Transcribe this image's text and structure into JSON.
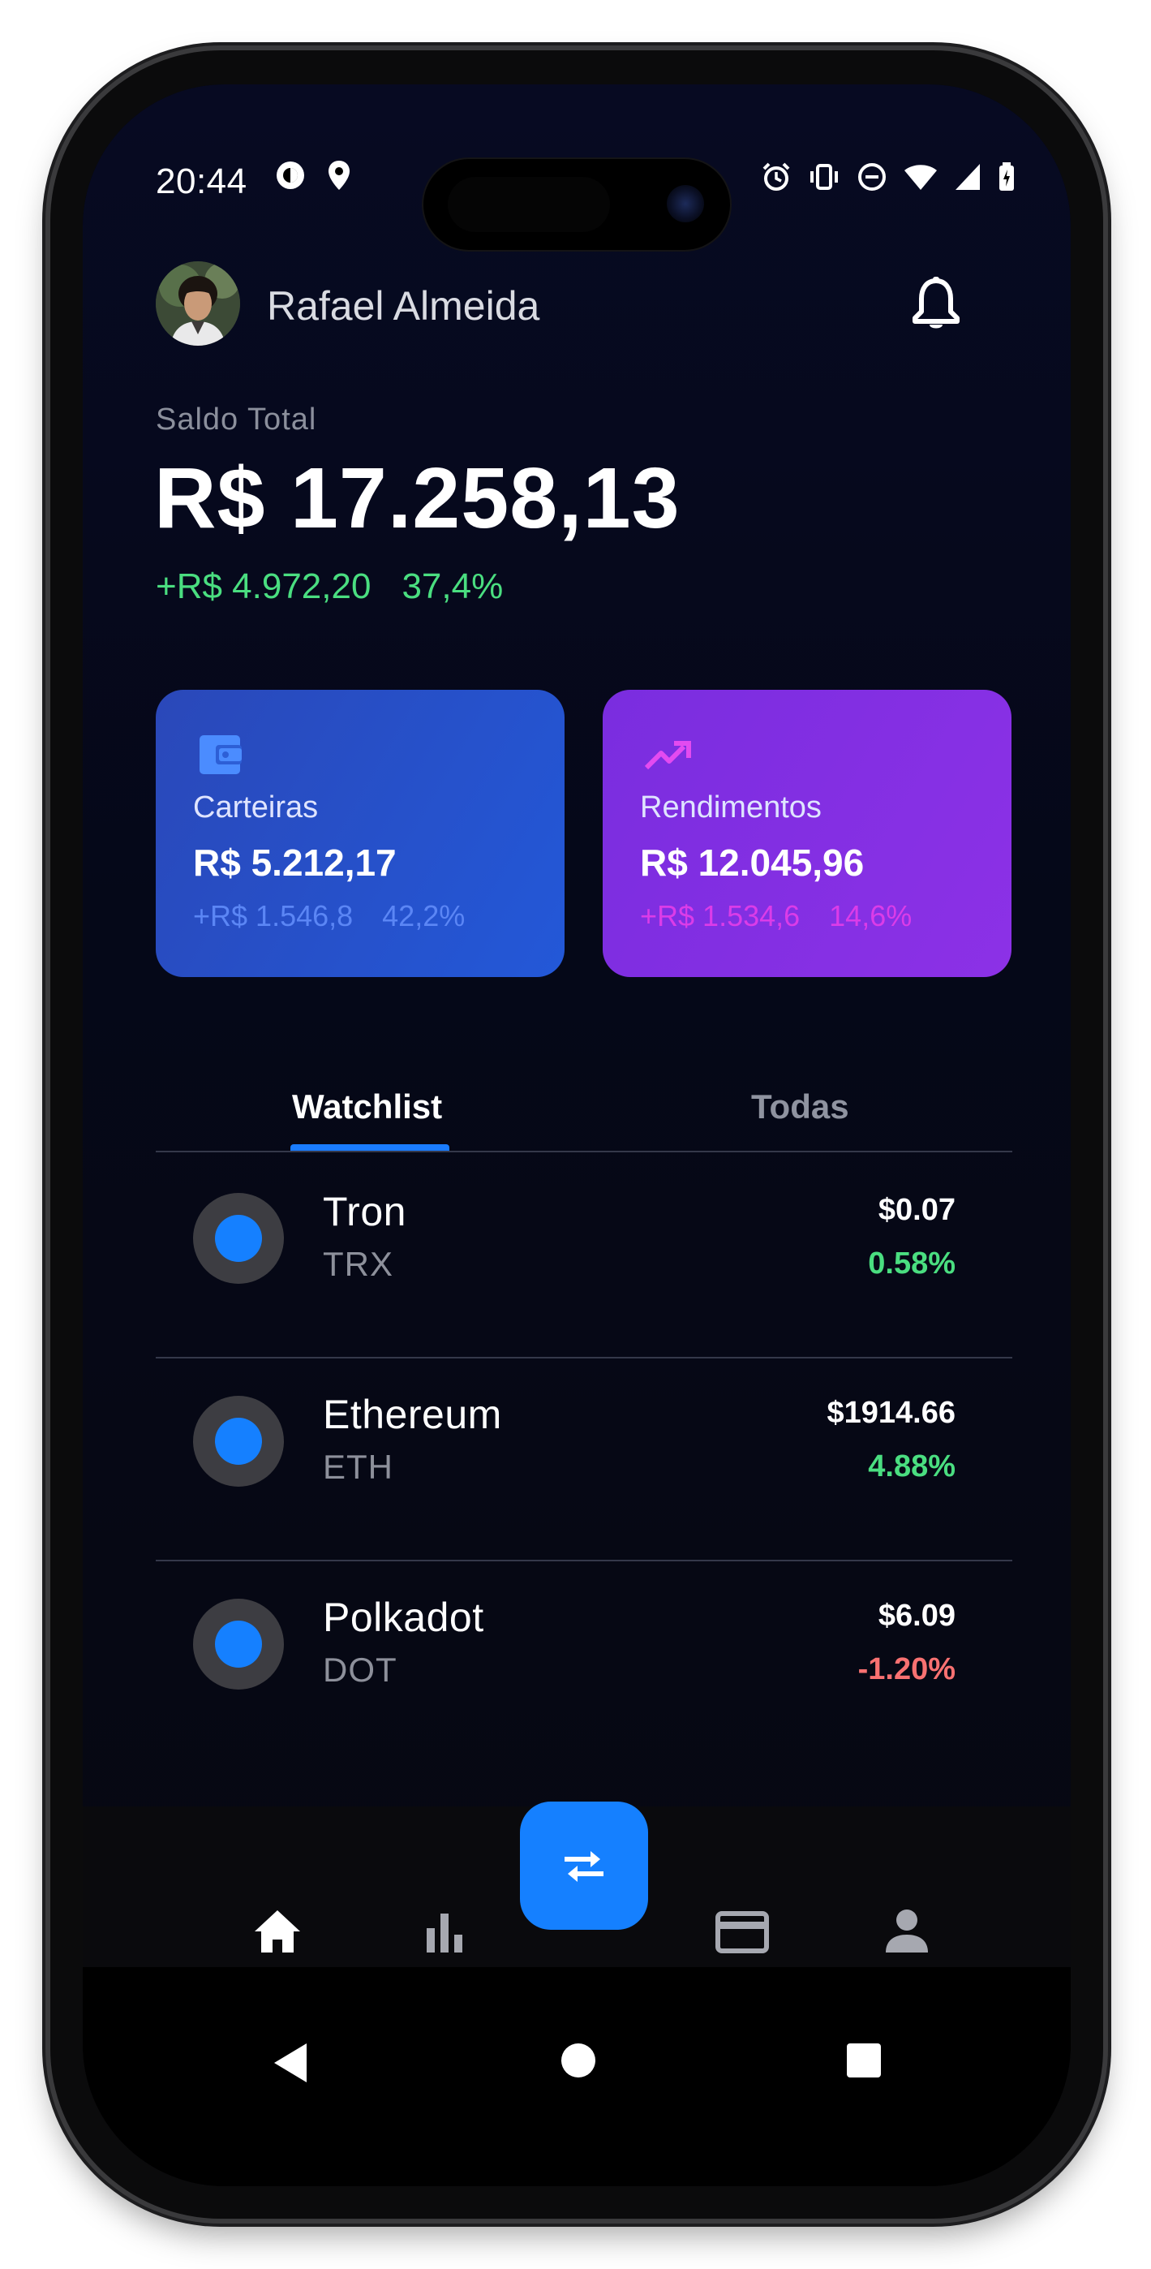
{
  "status_bar": {
    "time": "20:44",
    "left_icons": [
      "data-saver-icon",
      "location-icon"
    ],
    "right_icons": [
      "alarm-icon",
      "vibrate-icon",
      "dnd-icon",
      "wifi-icon",
      "signal-icon",
      "battery-icon"
    ]
  },
  "header": {
    "user_name": "Rafael Almeida",
    "avatar": "avatar",
    "notification_icon": "bell-icon"
  },
  "balance": {
    "label": "Saldo Total",
    "value": "R$ 17.258,13",
    "delta_amount": "+R$ 4.972,20",
    "delta_percent": "37,4%"
  },
  "cards": [
    {
      "icon": "wallet-icon",
      "label": "Carteiras",
      "value": "R$ 5.212,17",
      "delta_amount": "+R$ 1.546,8",
      "delta_percent": "42,2%",
      "color": "#2452d0"
    },
    {
      "icon": "trending-up-icon",
      "label": "Rendimentos",
      "value": "R$ 12.045,96",
      "delta_amount": "+R$ 1.534,6",
      "delta_percent": "14,6%",
      "color": "#8430e4"
    }
  ],
  "tabs": {
    "watchlist": "Watchlist",
    "all": "Todas",
    "active": "watchlist"
  },
  "coins": [
    {
      "name": "Tron",
      "symbol": "TRX",
      "price": "$0.07",
      "change": "0.58%",
      "trend": "up"
    },
    {
      "name": "Ethereum",
      "symbol": "ETH",
      "price": "$1914.66",
      "change": "4.88%",
      "trend": "up"
    },
    {
      "name": "Polkadot",
      "symbol": "DOT",
      "price": "$6.09",
      "change": "-1.20%",
      "trend": "down"
    }
  ],
  "bottom_nav": {
    "items": [
      "home-icon",
      "bar-chart-icon",
      "swap-icon",
      "card-icon",
      "profile-icon"
    ],
    "active": "home-icon"
  },
  "system_nav": [
    "back-icon",
    "home-circle-icon",
    "recents-icon"
  ],
  "colors": {
    "accent": "#1580ff",
    "positive": "#4ade80",
    "negative": "#f87171",
    "background": "#060818"
  }
}
